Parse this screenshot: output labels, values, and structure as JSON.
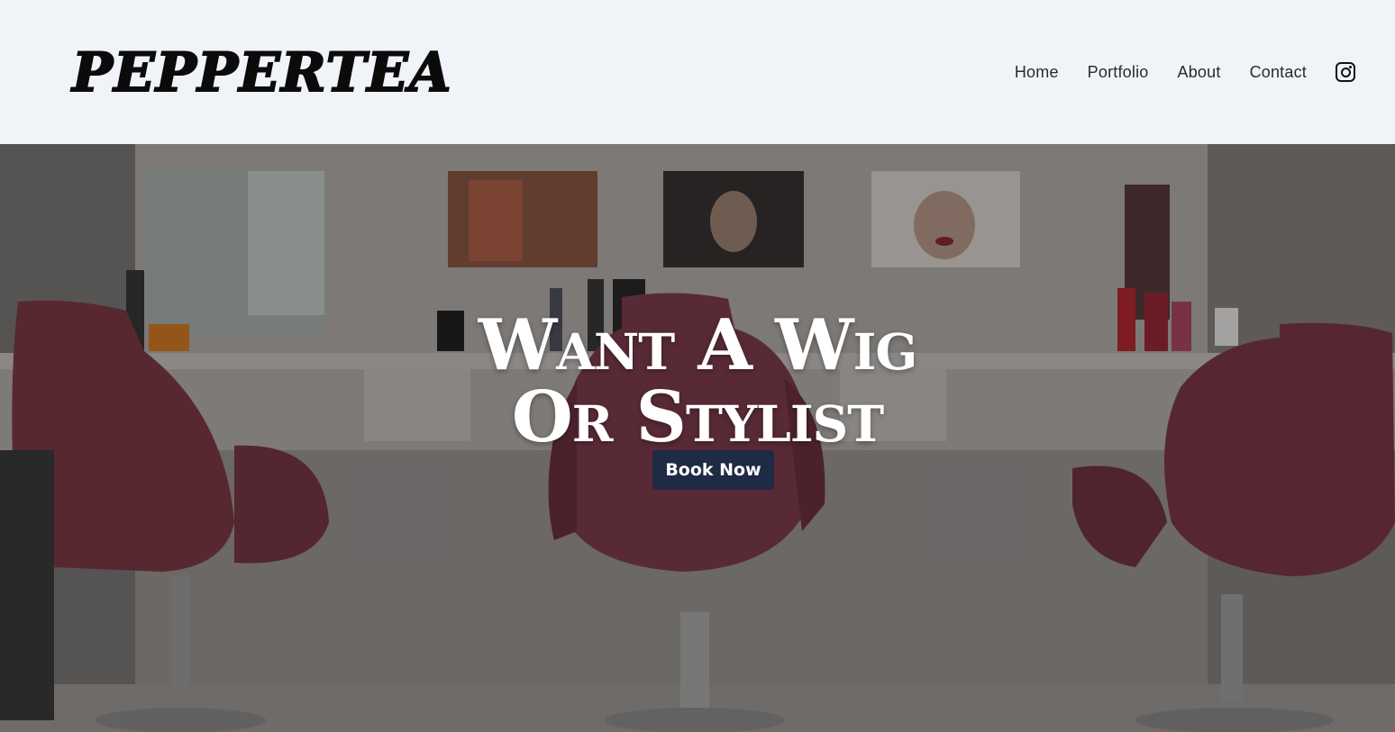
{
  "brand": {
    "logo": "PEPPERTEA"
  },
  "nav": {
    "items": [
      {
        "label": "Home"
      },
      {
        "label": "Portfolio"
      },
      {
        "label": "About"
      },
      {
        "label": "Contact"
      }
    ],
    "social_icon": "instagram-icon"
  },
  "hero": {
    "headline_line1": "Want A Wig",
    "headline_line2": "Or Stylist",
    "cta_label": "Book Now",
    "image_subject": "salon interior with three burgundy styling chairs",
    "colors": {
      "cta_background": "#1f2a44",
      "chair": "#7a3a48"
    }
  }
}
